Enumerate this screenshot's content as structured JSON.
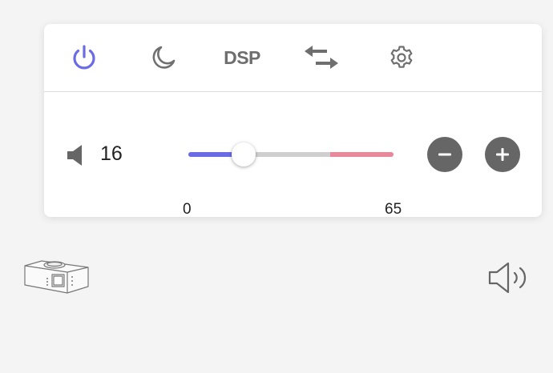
{
  "toolbar": {
    "buttons": [
      {
        "name": "power",
        "icon": "power-icon",
        "color": "#6b6be6",
        "active": true
      },
      {
        "name": "sleep",
        "icon": "moon-icon",
        "color": "#707070"
      },
      {
        "name": "dsp",
        "label": "DSP",
        "color": "#6e6e6e"
      },
      {
        "name": "swap",
        "icon": "swap-arrows-icon",
        "color": "#6e6e6e"
      },
      {
        "name": "settings",
        "icon": "gear-icon",
        "color": "#707070"
      }
    ]
  },
  "volume": {
    "value": "16",
    "min_label": "0",
    "max_label": "65",
    "level_fraction": 0.27,
    "low_color": "#6b6be6",
    "high_color": "#e8899b",
    "track_color": "#cfcfcf",
    "minus_icon": "minus-icon",
    "plus_icon": "plus-icon"
  },
  "footer": {
    "device_icon": "audio-device-icon",
    "speaker_icon": "speaker-icon"
  }
}
